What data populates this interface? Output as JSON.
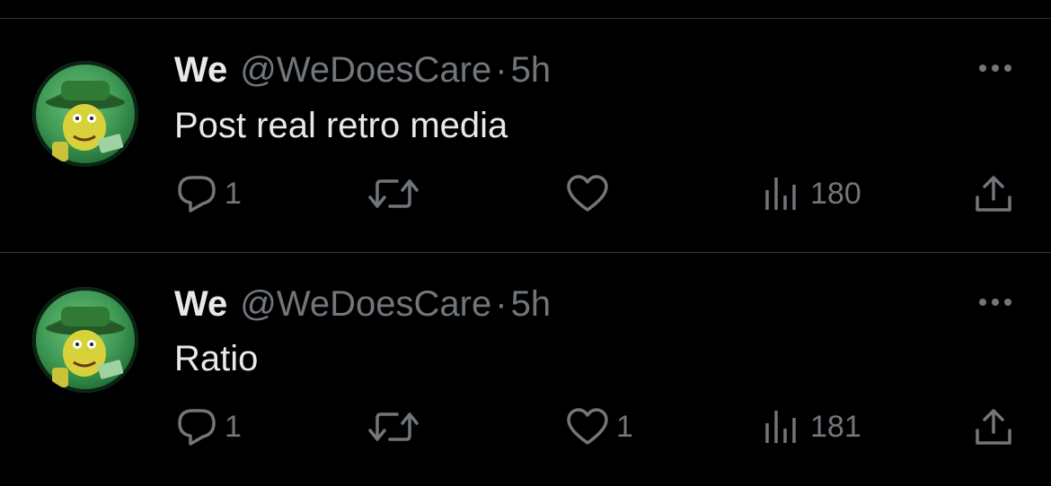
{
  "posts": [
    {
      "author_name": "We",
      "handle": "@WeDoesCare",
      "separator": "·",
      "time": "5h",
      "text": "Post real retro media",
      "replies": "1",
      "reposts": "",
      "likes": "",
      "views": "180"
    },
    {
      "author_name": "We",
      "handle": "@WeDoesCare",
      "separator": "·",
      "time": "5h",
      "text": "Ratio",
      "replies": "1",
      "reposts": "",
      "likes": "1",
      "views": "181"
    }
  ],
  "icons": {
    "reply": "reply-icon",
    "repost": "repost-icon",
    "like": "heart-icon",
    "views": "views-icon",
    "share": "share-icon",
    "more": "more-icon"
  },
  "colors": {
    "background": "#000000",
    "primary_text": "#e7e9ea",
    "secondary_text": "#71767b",
    "divider": "#2f3336",
    "avatar_green": "#3f9a55"
  }
}
